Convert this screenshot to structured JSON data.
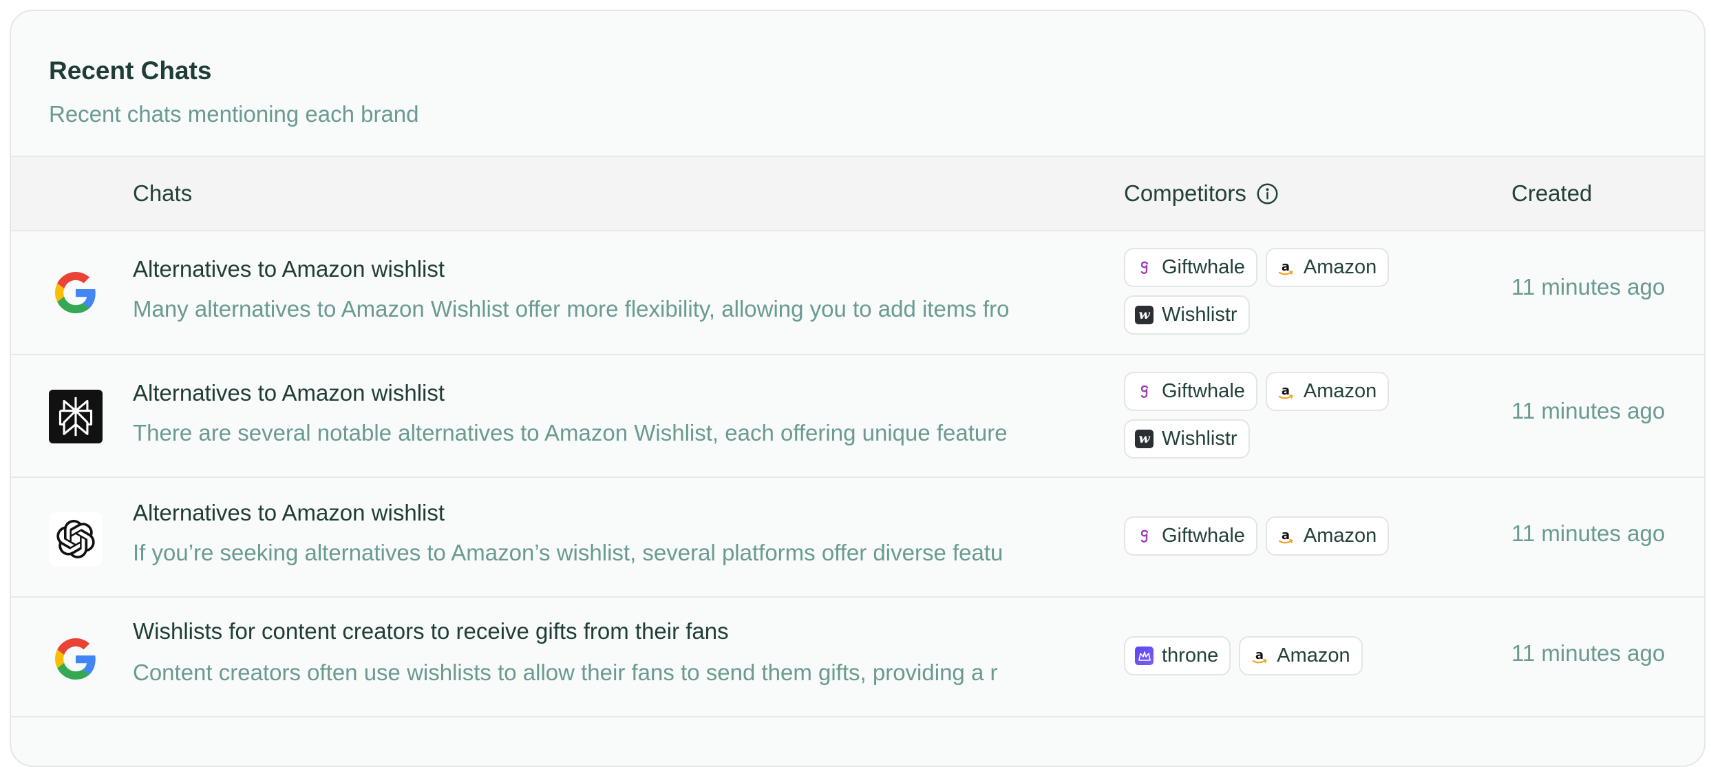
{
  "header": {
    "title": "Recent Chats",
    "subtitle": "Recent chats mentioning each brand"
  },
  "columns": {
    "chats": "Chats",
    "competitors": "Competitors",
    "created": "Created"
  },
  "rows": [
    {
      "source_icon": "google-icon",
      "title": "Alternatives to Amazon wishlist",
      "snippet": "Many alternatives to Amazon Wishlist offer more flexibility, allowing you to add items fro",
      "competitors": [
        {
          "name": "Giftwhale",
          "icon": "giftwhale-icon"
        },
        {
          "name": "Amazon",
          "icon": "amazon-icon"
        },
        {
          "name": "Wishlistr",
          "icon": "wishlistr-icon"
        }
      ],
      "created": "11 minutes ago"
    },
    {
      "source_icon": "perplexity-icon",
      "title": "Alternatives to Amazon wishlist",
      "snippet": "There are several notable alternatives to Amazon Wishlist, each offering unique feature",
      "competitors": [
        {
          "name": "Giftwhale",
          "icon": "giftwhale-icon"
        },
        {
          "name": "Amazon",
          "icon": "amazon-icon"
        },
        {
          "name": "Wishlistr",
          "icon": "wishlistr-icon"
        }
      ],
      "created": "11 minutes ago"
    },
    {
      "source_icon": "openai-icon",
      "title": "Alternatives to Amazon wishlist",
      "snippet": "If you’re seeking alternatives to Amazon’s wishlist, several platforms offer diverse featu",
      "competitors": [
        {
          "name": "Giftwhale",
          "icon": "giftwhale-icon"
        },
        {
          "name": "Amazon",
          "icon": "amazon-icon"
        }
      ],
      "created": "11 minutes ago"
    },
    {
      "source_icon": "google-icon",
      "title": "Wishlists for content creators to receive gifts from their fans",
      "snippet": "Content creators often use wishlists to allow their fans to send them gifts, providing a r",
      "competitors": [
        {
          "name": "throne",
          "icon": "throne-icon"
        },
        {
          "name": "Amazon",
          "icon": "amazon-icon"
        }
      ],
      "created": "11 minutes ago"
    }
  ],
  "colors": {
    "title": "#1f3d36",
    "muted_teal": "#6a9a92",
    "card_bg": "#f8fbfa",
    "header_bg": "#f3f4f3",
    "border": "#e3e8e6",
    "giftwhale": "#9b3fb5",
    "amazon_arrow": "#f0a31c",
    "throne": "#5b47f0"
  }
}
